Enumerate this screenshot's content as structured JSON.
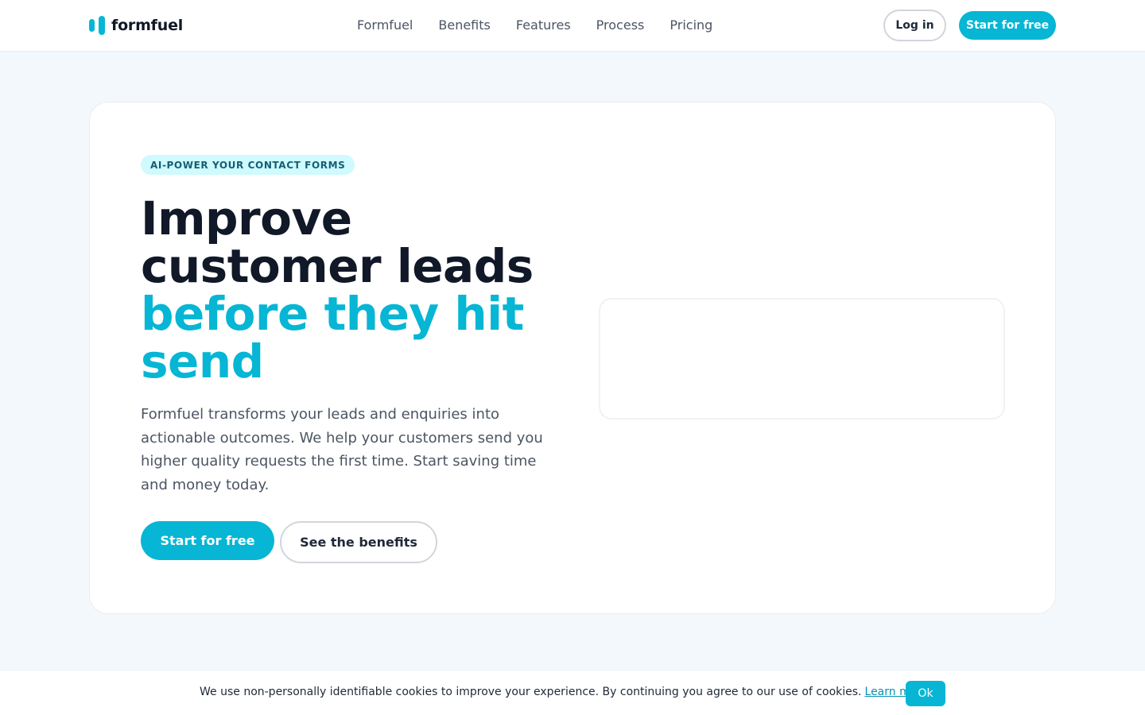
{
  "header": {
    "logo_text": "formfuel",
    "nav": [
      "Formfuel",
      "Benefits",
      "Features",
      "Process",
      "Pricing"
    ],
    "login_label": "Log in",
    "start_label": "Start for free"
  },
  "hero": {
    "badge": "AI-POWER YOUR CONTACT FORMS",
    "headline_dark_1": "Improve",
    "headline_dark_2": "customer leads",
    "headline_accent_1": "before they hit",
    "headline_accent_2": "send",
    "description": "Formfuel transforms your leads and enquiries into actionable outcomes. We help your customers send you higher quality requests the first time. Start saving time and money today.",
    "primary_cta": "Start for free",
    "secondary_cta": "See the benefits"
  },
  "cookie": {
    "text": "We use non-personally identifiable cookies to improve your experience. By continuing you agree to our use of cookies.",
    "link_label": "Learn more",
    "ok_label": "Ok"
  },
  "colors": {
    "accent": "#06b6d4",
    "badge_bg": "#cffafe",
    "text_dark": "#111827",
    "text_muted": "#4b5563",
    "page_bg": "#f3f8fc"
  }
}
